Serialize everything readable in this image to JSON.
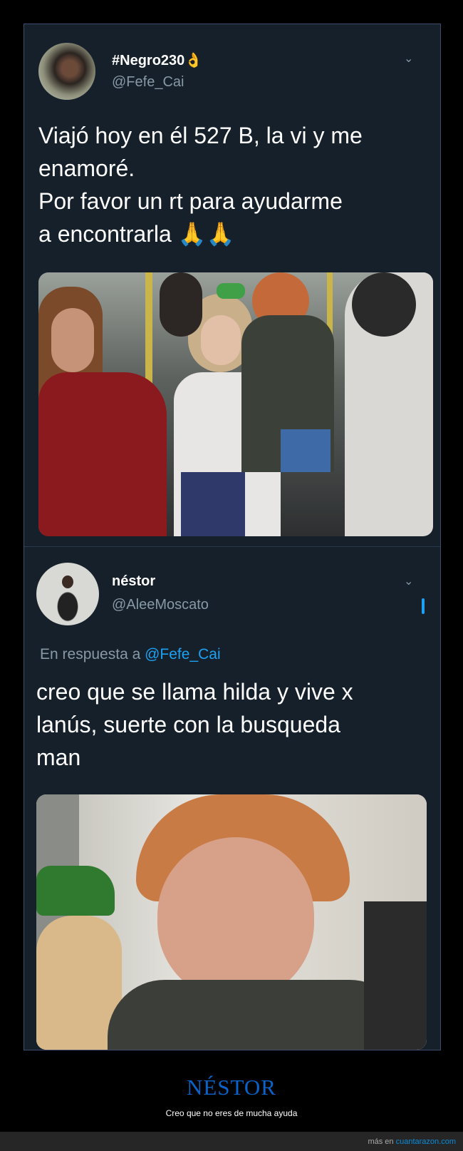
{
  "tweet1": {
    "display_name": "#Negro230",
    "name_emoji": "👌",
    "handle": "@Fefe_Cai",
    "text": "Viajó hoy en él 527 B, la vi y me\nenamoré.\nPor favor un rt para ayudarme\na encontrarla 🙏🙏",
    "avatar_icon": "profile-photo-couple",
    "menu_icon": "chevron-down-icon",
    "media_icon": "photo-bus-passengers"
  },
  "tweet2": {
    "display_name": "néstor",
    "handle": "@AleeMoscato",
    "reply_prefix": "En respuesta a",
    "reply_mention": "@Fefe_Cai",
    "text": "creo que se llama hilda y vive x\nlanús, suerte con la busqueda\nman",
    "avatar_icon": "profile-photo-man",
    "menu_icon": "chevron-down-icon",
    "media_icon": "photo-woman-closeup"
  },
  "caption": {
    "title": "NÉSTOR",
    "subtitle": "Creo que no eres de mucha ayuda"
  },
  "footer": {
    "prefix": "más en",
    "site": "cuantarazon.com"
  },
  "colors": {
    "background": "#15202b",
    "accent": "#1da1f2",
    "title": "#0a63c9"
  }
}
